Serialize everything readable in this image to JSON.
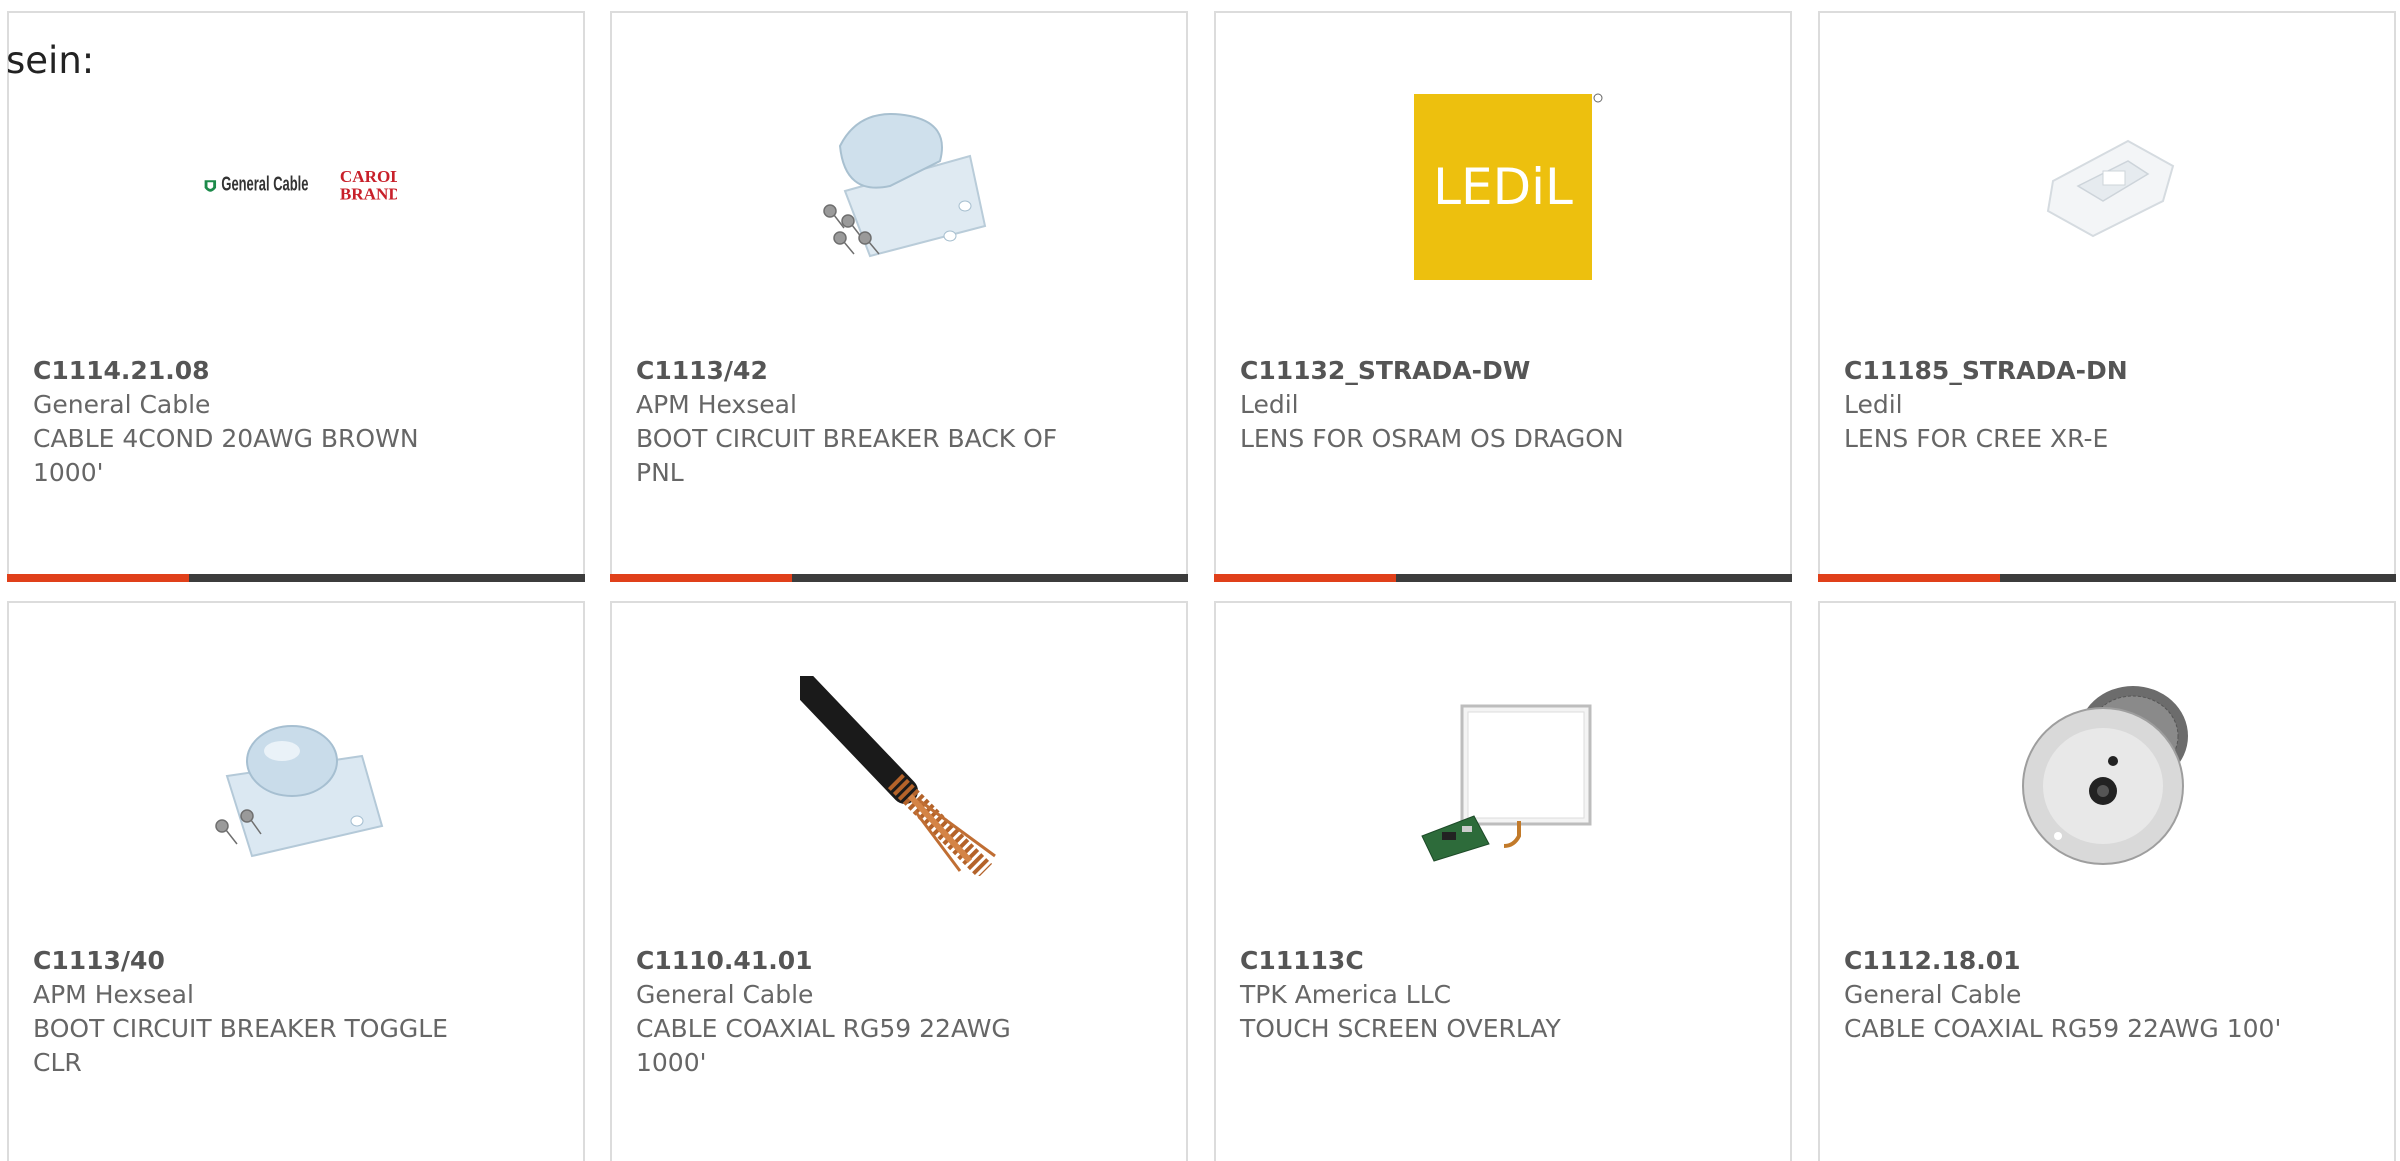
{
  "intro_text": "sein:",
  "colors": {
    "card_border": "#dcdcdc",
    "accent": "#e0401a",
    "bar_track": "#3c3c3c",
    "text": "#666666",
    "part_number": "#555555"
  },
  "products": [
    {
      "part_number": "C1114.21.08",
      "manufacturer": "General Cable",
      "description": "CABLE 4COND 20AWG BROWN 1000'",
      "image": "general-cable-carol-brand-logo",
      "bar_progress": 0.315
    },
    {
      "part_number": "C1113/42",
      "manufacturer": "APM Hexseal",
      "description": "BOOT CIRCUIT BREAKER BACK OF PNL",
      "image": "clear-boot-with-screws-photo",
      "bar_progress": 0.315
    },
    {
      "part_number": "C11132_STRADA-DW",
      "manufacturer": "Ledil",
      "description": "LENS FOR OSRAM OS DRAGON",
      "image": "ledil-logo",
      "bar_progress": 0.315
    },
    {
      "part_number": "C11185_STRADA-DN",
      "manufacturer": "Ledil",
      "description": "LENS FOR CREE XR-E",
      "image": "clear-lens-photo",
      "bar_progress": 0.315
    },
    {
      "part_number": "C1113/40",
      "manufacturer": "APM Hexseal",
      "description": "BOOT CIRCUIT BREAKER TOGGLE CLR",
      "image": "clear-toggle-boot-photo"
    },
    {
      "part_number": "C1110.41.01",
      "manufacturer": "General Cable",
      "description": "CABLE COAXIAL RG59 22AWG 1000'",
      "image": "coaxial-cable-photo"
    },
    {
      "part_number": "C11113C",
      "manufacturer": "TPK America LLC",
      "description": "TOUCH SCREEN OVERLAY",
      "image": "touch-screen-overlay-photo"
    },
    {
      "part_number": "C1112.18.01",
      "manufacturer": "General Cable",
      "description": "CABLE COAXIAL RG59 22AWG 100'",
      "image": "cable-spool-photo"
    }
  ]
}
